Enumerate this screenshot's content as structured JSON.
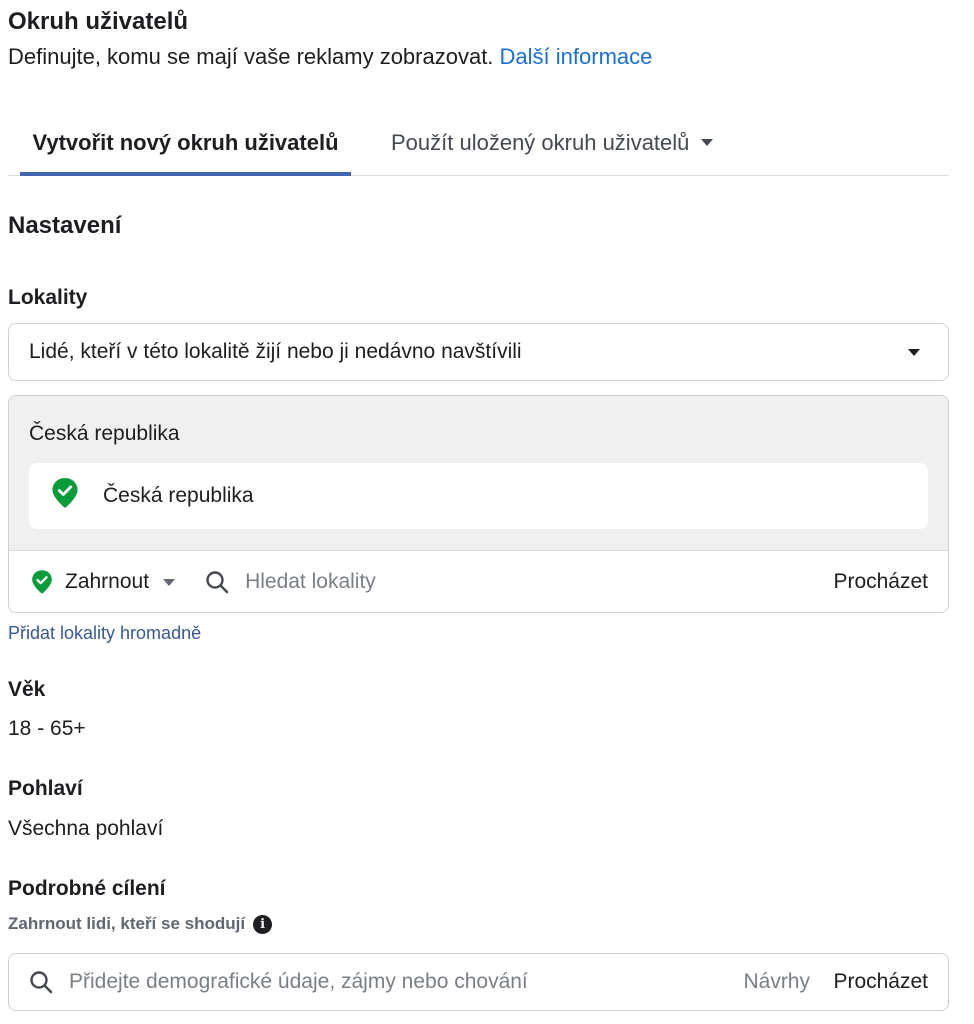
{
  "header": {
    "title": "Okruh uživatelů",
    "subtitle": "Definujte, komu se mají vaše reklamy zobrazovat.",
    "learn_more": "Další informace"
  },
  "tabs": {
    "create_new": "Vytvořit nový okruh uživatelů",
    "use_saved": "Použít uložený okruh uživatelů"
  },
  "settings": {
    "title": "Nastavení",
    "locations": {
      "label": "Lokality",
      "selected_option": "Lidé, kteří v této lokalitě žijí nebo ji nedávno navštívili",
      "country_group": "Česká republika",
      "included_locations": [
        "Česká republika"
      ],
      "include_mode": "Zahrnout",
      "search_placeholder": "Hledat lokality",
      "browse": "Procházet",
      "bulk_add": "Přidat lokality hromadně"
    },
    "age": {
      "label": "Věk",
      "value": "18 - 65+"
    },
    "gender": {
      "label": "Pohlaví",
      "value": "Všechna pohlaví"
    },
    "detailed_targeting": {
      "label": "Podrobné cílení",
      "sublabel": "Zahrnout lidi, kteří se shodují",
      "search_placeholder": "Přidejte demografické údaje, zájmy nebo chování",
      "suggestions": "Návrhy",
      "browse": "Procházet"
    }
  },
  "colors": {
    "link": "#1a6ed8",
    "tab_underline": "#4267b2",
    "pin_green": "#0a9b3a"
  }
}
